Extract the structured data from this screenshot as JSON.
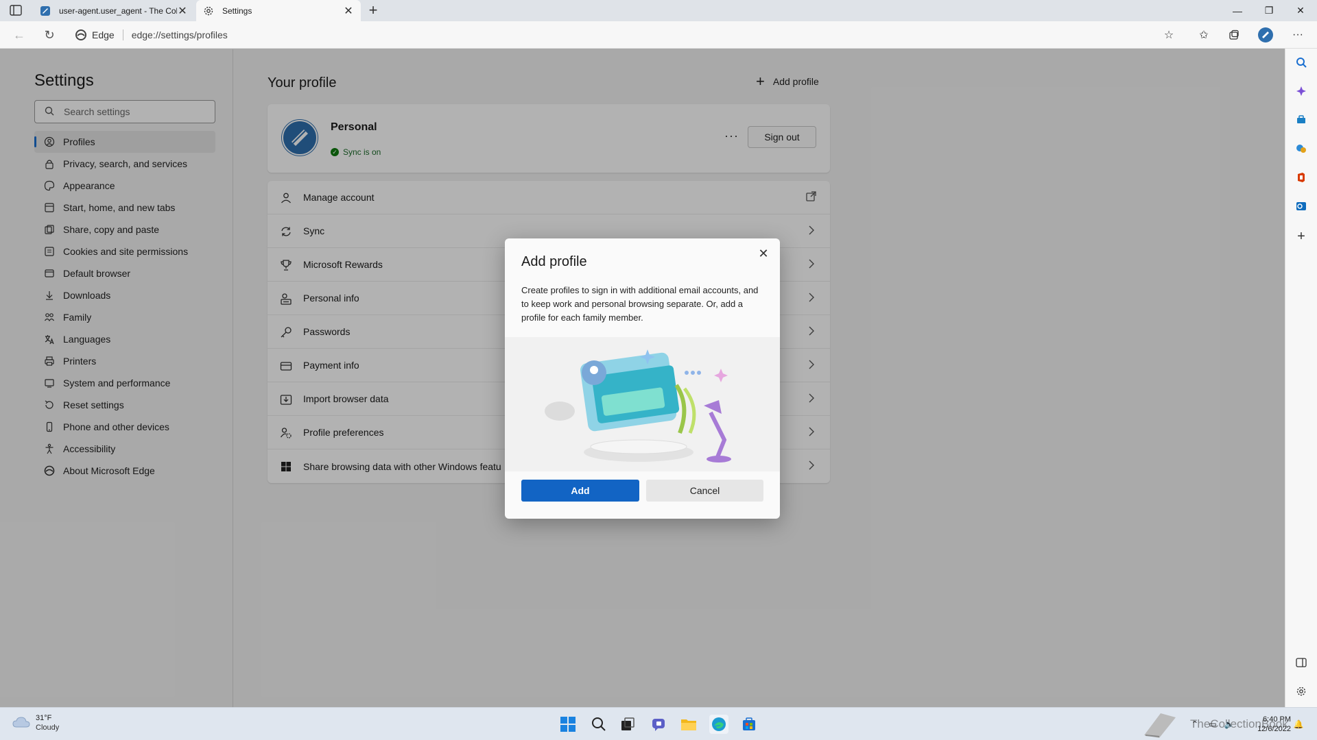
{
  "browser": {
    "tabs": [
      {
        "title": "user-agent.user_agent - The Coll",
        "active": false
      },
      {
        "title": "Settings",
        "active": true
      }
    ],
    "address": {
      "site_label": "Edge",
      "url": "edge://settings/profiles"
    }
  },
  "sidebar": {
    "title": "Settings",
    "search_placeholder": "Search settings",
    "items": [
      {
        "label": "Profiles",
        "icon": "profile-icon",
        "selected": true
      },
      {
        "label": "Privacy, search, and services",
        "icon": "lock-icon"
      },
      {
        "label": "Appearance",
        "icon": "palette-icon"
      },
      {
        "label": "Start, home, and new tabs",
        "icon": "home-tabs-icon"
      },
      {
        "label": "Share, copy and paste",
        "icon": "share-icon"
      },
      {
        "label": "Cookies and site permissions",
        "icon": "cookie-icon"
      },
      {
        "label": "Default browser",
        "icon": "browser-icon"
      },
      {
        "label": "Downloads",
        "icon": "download-icon"
      },
      {
        "label": "Family",
        "icon": "family-icon"
      },
      {
        "label": "Languages",
        "icon": "language-icon"
      },
      {
        "label": "Printers",
        "icon": "printer-icon"
      },
      {
        "label": "System and performance",
        "icon": "system-icon"
      },
      {
        "label": "Reset settings",
        "icon": "reset-icon"
      },
      {
        "label": "Phone and other devices",
        "icon": "phone-icon"
      },
      {
        "label": "Accessibility",
        "icon": "accessibility-icon"
      },
      {
        "label": "About Microsoft Edge",
        "icon": "edge-icon"
      }
    ]
  },
  "main": {
    "title": "Your profile",
    "add_profile_label": "Add profile",
    "profile": {
      "name": "Personal",
      "sync_status": "Sync is on",
      "more_label": "···",
      "sign_out_label": "Sign out"
    },
    "rows": [
      {
        "label": "Manage account",
        "icon": "person-icon",
        "trailing": "external-link-icon"
      },
      {
        "label": "Sync",
        "icon": "sync-icon",
        "trailing": "chevron-right-icon"
      },
      {
        "label": "Microsoft Rewards",
        "icon": "trophy-icon",
        "trailing": "chevron-right-icon"
      },
      {
        "label": "Personal info",
        "icon": "id-card-icon",
        "trailing": "chevron-right-icon"
      },
      {
        "label": "Passwords",
        "icon": "key-icon",
        "trailing": "chevron-right-icon"
      },
      {
        "label": "Payment info",
        "icon": "credit-card-icon",
        "trailing": "chevron-right-icon"
      },
      {
        "label": "Import browser data",
        "icon": "import-icon",
        "trailing": "chevron-right-icon"
      },
      {
        "label": "Profile preferences",
        "icon": "profile-settings-icon",
        "trailing": "chevron-right-icon"
      },
      {
        "label": "Share browsing data with other Windows featu",
        "icon": "windows-icon",
        "trailing": "chevron-right-icon"
      }
    ]
  },
  "dialog": {
    "title": "Add profile",
    "body": "Create profiles to sign in with additional email accounts, and to keep work and personal browsing separate. Or, add a profile for each family member.",
    "add_label": "Add",
    "cancel_label": "Cancel"
  },
  "taskbar": {
    "weather_temp": "31°F",
    "weather_cond": "Cloudy",
    "time": "6:40 PM",
    "date": "12/6/2022",
    "watermark": "TheCollectionBook"
  },
  "colors": {
    "accent": "#1264c4",
    "sync_green": "#107c10"
  }
}
